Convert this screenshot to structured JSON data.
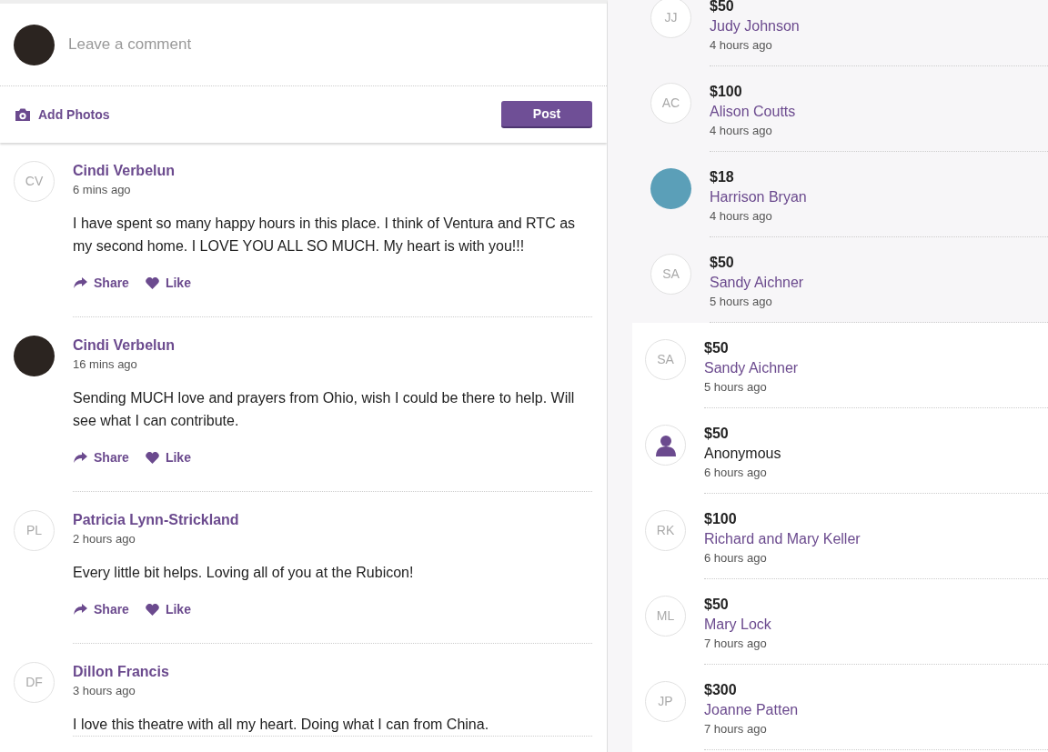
{
  "composer": {
    "avatar": {
      "kind": "photo"
    },
    "placeholder": "Leave a comment",
    "add_photos": "Add Photos",
    "post_button": "Post"
  },
  "comments": [
    {
      "avatar": {
        "kind": "initials",
        "initials": "CV"
      },
      "name": "Cindi Verbelun",
      "time": "6 mins ago",
      "text": "I have spent so many happy hours in this place. I think of Ventura and RTC as my second home. I LOVE YOU ALL SO MUCH. My heart is with you!!!",
      "actions": [
        {
          "kind": "share",
          "label": "Share"
        },
        {
          "kind": "like",
          "label": "Like"
        }
      ]
    },
    {
      "avatar": {
        "kind": "photo"
      },
      "name": "Cindi Verbelun",
      "time": "16 mins ago",
      "text": "Sending MUCH love and prayers from Ohio, wish I could be there to help. Will see what I can contribute.",
      "actions": [
        {
          "kind": "share",
          "label": "Share"
        },
        {
          "kind": "like",
          "label": "Like"
        }
      ]
    },
    {
      "avatar": {
        "kind": "initials",
        "initials": "PL"
      },
      "name": "Patricia Lynn-Strickland",
      "time": "2 hours ago",
      "text": "Every little bit helps. Loving all of you at the Rubicon!",
      "actions": [
        {
          "kind": "share",
          "label": "Share"
        },
        {
          "kind": "like",
          "label": "Like"
        }
      ]
    },
    {
      "avatar": {
        "kind": "initials",
        "initials": "DF"
      },
      "name": "Dillon Francis",
      "time": "3 hours ago",
      "text": "I love this theatre with all my heart. Doing what I can from China."
    }
  ],
  "donations": [
    {
      "avatar": {
        "kind": "initials",
        "initials": "JJ"
      },
      "amount": "$50",
      "name": "Judy Johnson",
      "time": "4 hours ago",
      "anonymous": false
    },
    {
      "avatar": {
        "kind": "initials",
        "initials": "AC"
      },
      "amount": "$100",
      "name": "Alison Coutts",
      "time": "4 hours ago",
      "anonymous": false
    },
    {
      "avatar": {
        "kind": "photo"
      },
      "amount": "$18",
      "name": "Harrison Bryan",
      "time": "4 hours ago",
      "anonymous": false
    },
    {
      "avatar": {
        "kind": "initials",
        "initials": "SA"
      },
      "amount": "$50",
      "name": "Sandy Aichner",
      "time": "5 hours ago",
      "anonymous": false
    }
  ],
  "recent_donations": [
    {
      "avatar": {
        "kind": "initials",
        "initials": "SA"
      },
      "amount": "$50",
      "name": "Sandy Aichner",
      "time": "5 hours ago",
      "anonymous": false
    },
    {
      "avatar": {
        "kind": "anonymous"
      },
      "amount": "$50",
      "name": "Anonymous",
      "time": "6 hours ago",
      "anonymous": true
    },
    {
      "avatar": {
        "kind": "initials",
        "initials": "RK"
      },
      "amount": "$100",
      "name": "Richard and Mary Keller",
      "time": "6 hours ago",
      "anonymous": false
    },
    {
      "avatar": {
        "kind": "initials",
        "initials": "ML"
      },
      "amount": "$50",
      "name": "Mary Lock",
      "time": "7 hours ago",
      "anonymous": false
    },
    {
      "avatar": {
        "kind": "initials",
        "initials": "JP"
      },
      "amount": "$300",
      "name": "Joanne Patten",
      "time": "7 hours ago",
      "anonymous": false
    }
  ]
}
